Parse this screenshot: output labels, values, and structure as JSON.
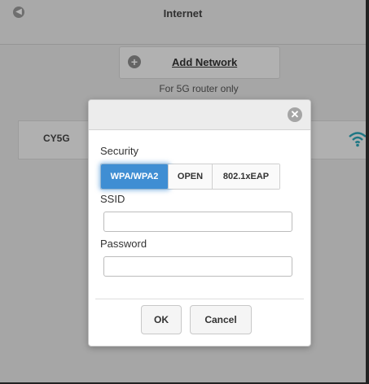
{
  "header": {
    "title": "Internet"
  },
  "add_network": {
    "label": "Add Network"
  },
  "note": "For 5G router only",
  "networks": [
    {
      "name": "CY5G"
    }
  ],
  "dialog": {
    "security_label": "Security",
    "security_options": [
      "WPA/WPA2",
      "OPEN",
      "802.1xEAP"
    ],
    "selected_security": "WPA/WPA2",
    "ssid_label": "SSID",
    "ssid_value": "",
    "password_label": "Password",
    "password_value": "",
    "ok_label": "OK",
    "cancel_label": "Cancel"
  },
  "colors": {
    "accent": "#3f8ed3",
    "wifi": "#2aa6b8"
  },
  "icons": {
    "back": "back-icon",
    "add": "plus-circle-icon",
    "wifi": "wifi-icon",
    "close": "close-icon"
  }
}
